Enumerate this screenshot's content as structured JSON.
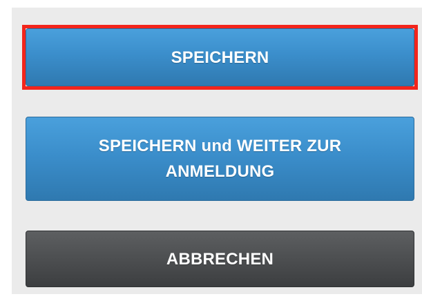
{
  "form_actions": {
    "save_label": "SPEICHERN",
    "save_continue_label": "SPEICHERN und WEITER ZUR ANMELDUNG",
    "cancel_label": "ABBRECHEN"
  },
  "colors": {
    "primary_button": "#3b8ecb",
    "secondary_button": "#4b4d4f",
    "highlight_border": "#f2251c",
    "panel_background": "#ebebeb"
  }
}
